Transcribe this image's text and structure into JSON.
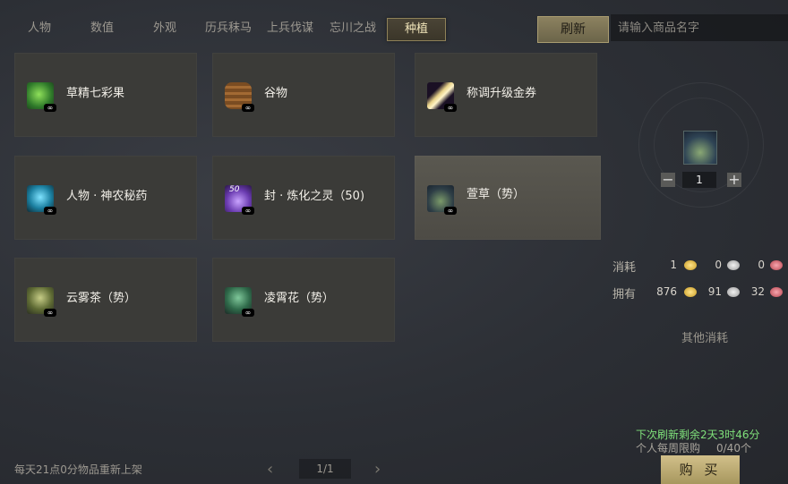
{
  "tabs": [
    {
      "label": "人物"
    },
    {
      "label": "数值"
    },
    {
      "label": "外观"
    },
    {
      "label": "历兵秣马"
    },
    {
      "label": "上兵伐谋"
    },
    {
      "label": "忘川之战"
    },
    {
      "label": "种植"
    }
  ],
  "active_tab": "种植",
  "refresh_label": "刷新",
  "search": {
    "placeholder": "请输入商品名字",
    "value": ""
  },
  "items": [
    {
      "name": "草精七彩果",
      "icon": "green-fruit-icon"
    },
    {
      "name": "谷物",
      "icon": "grain-bale-icon"
    },
    {
      "name": "称调升级金券",
      "icon": "gold-ticket-icon"
    },
    {
      "name": "人物 · 神农秘药",
      "icon": "blue-potion-icon"
    },
    {
      "name": "封 · 炼化之灵（50)",
      "icon": "purple-spirit-icon",
      "badge": "50"
    },
    {
      "name": "萱草（势）",
      "icon": "daylily-grass-icon"
    },
    {
      "name": "云雾茶（势）",
      "icon": "tea-bush-icon"
    },
    {
      "name": "凌霄花（势）",
      "icon": "trumpet-vine-icon"
    }
  ],
  "infinite_mark": "∞",
  "detail": {
    "quantity": "1",
    "minus": "−",
    "plus": "+",
    "cost_label": "消耗",
    "own_label": "拥有",
    "cost": [
      "1",
      "0",
      "0"
    ],
    "own": [
      "876",
      "91",
      "32"
    ],
    "other_cost": "其他消耗",
    "refresh_timer": "下次刷新剩余2天3时46分",
    "weekly_limit": "个人每周限购",
    "weekly_value": "0/40个",
    "buy_label": "购 买",
    "colors": {
      "timer": "#7fe07a",
      "buy_button": "#c9b77f"
    }
  },
  "footer": {
    "note": "每天21点0分物品重新上架",
    "page": "1/1",
    "prev": "‹",
    "next": "›"
  }
}
